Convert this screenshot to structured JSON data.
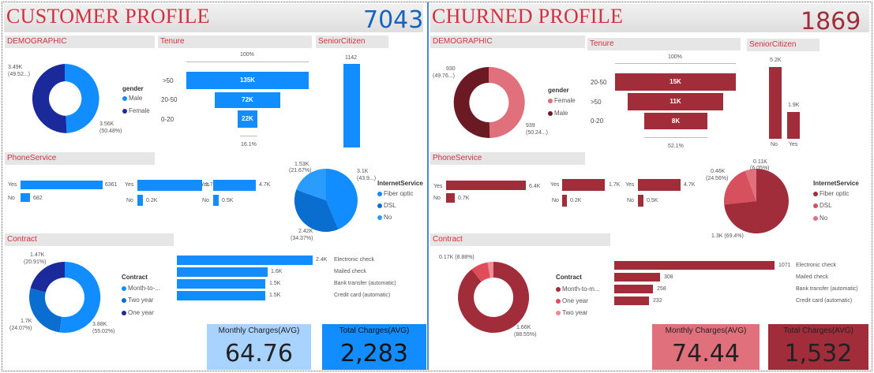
{
  "colors": {
    "blue_dark": "#1b2a9a",
    "blue": "#118dff",
    "blue_mid": "#0a6ed1",
    "blue_light": "#a8d2ff",
    "red_dark": "#a12d3a",
    "red_mid": "#d6505e",
    "red_light": "#e0707b",
    "maroon": "#6b1a24",
    "title_red": "#d2313f",
    "title_blue": "#1565c0"
  },
  "customer": {
    "title": "CUSTOMER PROFILE",
    "count": "7043",
    "demographic": {
      "section": "DEMOGRAPHIC",
      "legend_title": "gender",
      "legend": [
        "Male",
        "Female"
      ],
      "label_a": "3.49K",
      "label_a_pct": "(49.52...)",
      "label_b": "3.56K",
      "label_b_pct": "(50.48%)",
      "chart_data": {
        "type": "pie",
        "categories": [
          "Male",
          "Female"
        ],
        "values": [
          3560,
          3490
        ]
      }
    },
    "tenure": {
      "section": "Tenure",
      "top_pct": "100%",
      "bottom_pct": "16.1%",
      "categories": [
        ">50",
        "20-50",
        "0-20"
      ],
      "labels": [
        "135K",
        "72K",
        "22K"
      ],
      "chart_data": {
        "type": "bar",
        "categories": [
          ">50",
          "20-50",
          "0-20"
        ],
        "values": [
          135000,
          72000,
          22000
        ]
      }
    },
    "senior": {
      "section": "SeniorCitizen",
      "label": "1142",
      "chart_data": {
        "type": "bar",
        "values": [
          1142
        ]
      }
    },
    "phone": {
      "section": "PhoneService",
      "g1": {
        "yes": "Yes",
        "no": "No",
        "yes_v": "6361",
        "no_v": "682"
      },
      "g2": {
        "yes": "Yes",
        "no": "No",
        "yes_v": "1.7K",
        "no_v": "0.2K"
      },
      "g3": {
        "yes": "Yes",
        "no": "No",
        "yes_v": "4.7K",
        "no_v": "0.5K"
      },
      "chart_data": [
        {
          "type": "bar",
          "categories": [
            "Yes",
            "No"
          ],
          "values": [
            6361,
            682
          ]
        },
        {
          "type": "bar",
          "categories": [
            "Yes",
            "No"
          ],
          "values": [
            1700,
            200
          ]
        },
        {
          "type": "bar",
          "categories": [
            "Yes",
            "No"
          ],
          "values": [
            4700,
            500
          ]
        }
      ]
    },
    "internet": {
      "legend_title": "InternetService",
      "legend": [
        "Fiber optic",
        "DSL",
        "No"
      ],
      "l1": "1.53K",
      "l1p": "(21.67%)",
      "l2": "3.1K",
      "l2p": "(43.9...)",
      "l3": "2.42K",
      "l3p": "(34.37%)",
      "chart_data": {
        "type": "pie",
        "categories": [
          "Fiber optic",
          "DSL",
          "No"
        ],
        "values": [
          3100,
          2420,
          1530
        ]
      }
    },
    "contract": {
      "section": "Contract",
      "legend_title": "Contract",
      "legend": [
        "Month-to-...",
        "Two year",
        "One year"
      ],
      "l1": "1.47K",
      "l1p": "(20.91%)",
      "l2": "1.7K",
      "l2p": "(24.07%)",
      "l3": "3.88K",
      "l3p": "(55.02%)",
      "chart_data": {
        "type": "pie",
        "categories": [
          "Month-to-month",
          "Two year",
          "One year"
        ],
        "values": [
          3880,
          1700,
          1470
        ]
      }
    },
    "payment": {
      "categories": [
        "Electronic check",
        "Mailed check",
        "Bank transfer (automatic)",
        "Credit card (automatic)"
      ],
      "labels": [
        "2.4K",
        "1.6K",
        "1.5K",
        "1.5K"
      ],
      "chart_data": {
        "type": "bar",
        "categories": [
          "Electronic check",
          "Mailed check",
          "Bank transfer (automatic)",
          "Credit card (automatic)"
        ],
        "values": [
          2400,
          1600,
          1500,
          1500
        ]
      }
    },
    "monthly": {
      "label": "Monthly Charges(AVG)",
      "value": "64.76"
    },
    "total": {
      "label": "Total Charges(AVG)",
      "value": "2,283"
    }
  },
  "churned": {
    "title": "CHURNED PROFILE",
    "count": "1869",
    "demographic": {
      "section": "DEMOGRAPHIC",
      "legend_title": "gender",
      "legend": [
        "Female",
        "Male"
      ],
      "label_a": "930",
      "label_a_pct": "(49.76...)",
      "label_b": "939",
      "label_b_pct": "(50.24...)",
      "chart_data": {
        "type": "pie",
        "categories": [
          "Female",
          "Male"
        ],
        "values": [
          939,
          930
        ]
      }
    },
    "tenure": {
      "section": "Tenure",
      "top_pct": "100%",
      "bottom_pct": "52.1%",
      "categories": [
        "20-50",
        ">50",
        "0-20"
      ],
      "labels": [
        "15K",
        "11K",
        "8K"
      ],
      "chart_data": {
        "type": "bar",
        "categories": [
          "20-50",
          ">50",
          "0-20"
        ],
        "values": [
          15000,
          11000,
          8000
        ]
      }
    },
    "senior": {
      "section": "SeniorCitizen",
      "labels": [
        "5.2K",
        "1.9K"
      ],
      "categories": [
        "No",
        "Yes"
      ],
      "chart_data": {
        "type": "bar",
        "categories": [
          "No",
          "Yes"
        ],
        "values": [
          5200,
          1900
        ]
      }
    },
    "phone": {
      "section": "PhoneService",
      "g1": {
        "yes": "Yes",
        "no": "No",
        "yes_v": "6.4K",
        "no_v": "0.7K"
      },
      "g2": {
        "yes": "Yes",
        "no": "No",
        "yes_v": "1.7K",
        "no_v": "0.2K"
      },
      "g3": {
        "yes": "Yes",
        "no": "No",
        "yes_v": "4.7K",
        "no_v": "0.5K"
      },
      "chart_data": [
        {
          "type": "bar",
          "categories": [
            "Yes",
            "No"
          ],
          "values": [
            6400,
            700
          ]
        },
        {
          "type": "bar",
          "categories": [
            "Yes",
            "No"
          ],
          "values": [
            1700,
            200
          ]
        },
        {
          "type": "bar",
          "categories": [
            "Yes",
            "No"
          ],
          "values": [
            4700,
            500
          ]
        }
      ]
    },
    "internet": {
      "legend_title": "InternetService",
      "legend": [
        "Fiber optic",
        "DSL",
        "No"
      ],
      "l1": "0.11K",
      "l1p": "(6.05%)",
      "l2": "0.46K",
      "l2p": "(24.56%)",
      "l3": "1.3K (69.4%)",
      "chart_data": {
        "type": "pie",
        "categories": [
          "Fiber optic",
          "DSL",
          "No"
        ],
        "values": [
          1300,
          460,
          110
        ]
      }
    },
    "contract": {
      "section": "Contract",
      "legend_title": "Contract",
      "legend": [
        "Month-to-m...",
        "One year",
        "Two year"
      ],
      "l1": "0.17K (8.88%)",
      "l2": "1.66K",
      "l2p": "(88.55%)",
      "chart_data": {
        "type": "pie",
        "categories": [
          "Month-to-month",
          "One year",
          "Two year"
        ],
        "values": [
          1660,
          170,
          48
        ]
      }
    },
    "payment": {
      "categories": [
        "Electronic check",
        "Mailed check",
        "Bank transfer (automatic)",
        "Credit card (automatic)"
      ],
      "labels": [
        "1071",
        "308",
        "258",
        "232"
      ],
      "chart_data": {
        "type": "bar",
        "categories": [
          "Electronic check",
          "Mailed check",
          "Bank transfer (automatic)",
          "Credit card (automatic)"
        ],
        "values": [
          1071,
          308,
          258,
          232
        ]
      }
    },
    "monthly": {
      "label": "Monthly Charges(AVG)",
      "value": "74.44"
    },
    "total": {
      "label": "Total Charges(AVG)",
      "value": "1,532"
    }
  }
}
